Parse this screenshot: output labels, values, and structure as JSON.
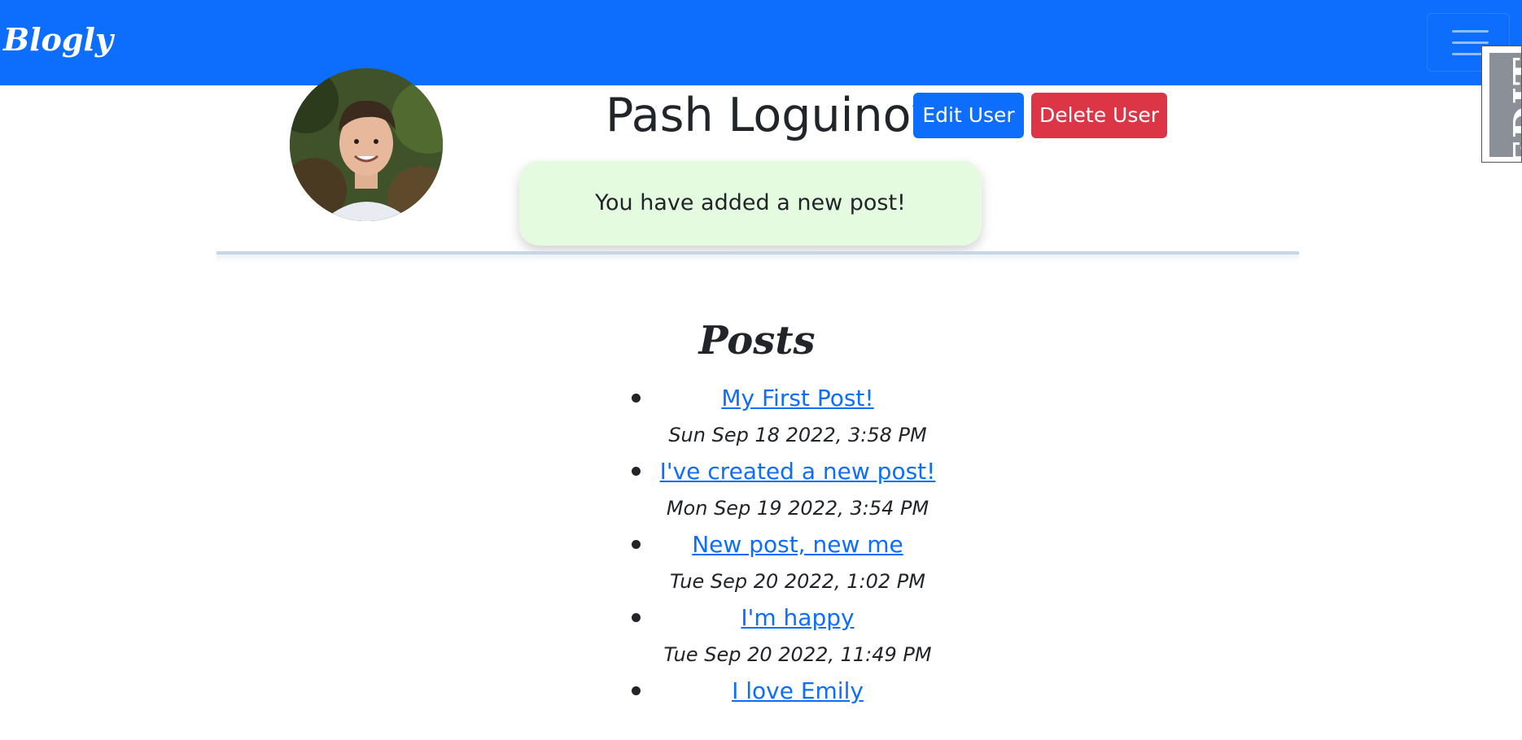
{
  "navbar": {
    "brand": "Blogly",
    "background_color": "#0d6efd",
    "toggler_icon": "hamburger-menu-icon"
  },
  "side_tab": {
    "label": "EDIT"
  },
  "user": {
    "name": "Pash Loguinov",
    "avatar_icon": "profile-photo",
    "edit_label": "Edit User",
    "delete_label": "Delete User"
  },
  "flash": {
    "message": "You have added a new post!"
  },
  "posts": {
    "heading": "Posts",
    "items": [
      {
        "title": "My First Post!",
        "date": "Sun Sep 18 2022, 3:58 PM"
      },
      {
        "title": "I've created a new post!",
        "date": "Mon Sep 19 2022, 3:54 PM"
      },
      {
        "title": "New post, new me",
        "date": "Tue Sep 20 2022, 1:02 PM"
      },
      {
        "title": "I'm happy",
        "date": "Tue Sep 20 2022, 11:49 PM"
      },
      {
        "title": "I love Emily",
        "date": ""
      }
    ]
  },
  "colors": {
    "primary": "#0d6efd",
    "danger": "#dc3545",
    "success_bg": "#e5fbe0"
  }
}
